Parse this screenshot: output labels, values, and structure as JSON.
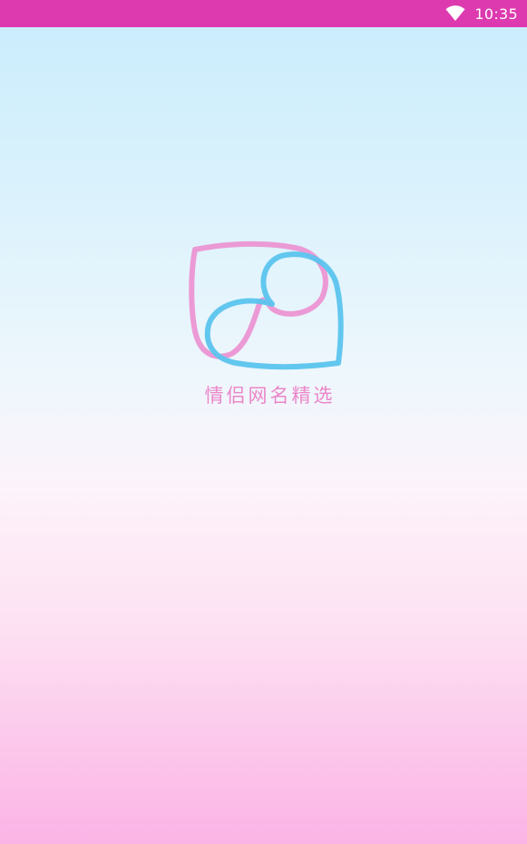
{
  "status_bar": {
    "time": "10:35",
    "wifi_icon": "wifi-icon",
    "background_color": "#dd3aaf"
  },
  "splash": {
    "logo_icon": "double-heart-logo-icon",
    "app_name": "情侣网名精选",
    "logo_colors": {
      "pink": "#ec90d0",
      "blue": "#5bc4ee"
    },
    "text_color": "#ec86c9"
  }
}
